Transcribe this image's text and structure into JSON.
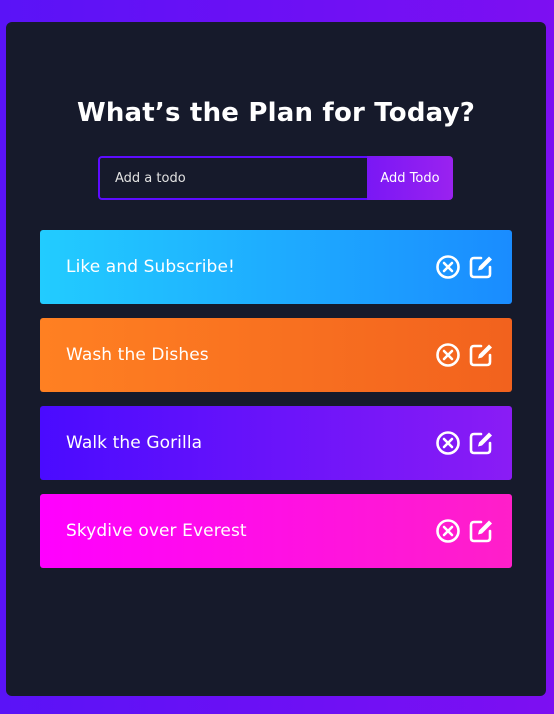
{
  "header": {
    "title": "What’s the Plan for Today?"
  },
  "form": {
    "placeholder": "Add a todo",
    "button_label": "Add Todo"
  },
  "todos": [
    {
      "text": "Like and Subscribe!",
      "gradient": [
        "#22ccff",
        "#1a8cff"
      ]
    },
    {
      "text": "Wash the Dishes",
      "gradient": [
        "#ff8022",
        "#f2621e"
      ]
    },
    {
      "text": "Walk the Gorilla",
      "gradient": [
        "#4a0bff",
        "#8a1cf5"
      ]
    },
    {
      "text": "Skydive over Everest",
      "gradient": [
        "#ff00ff",
        "#ff1fc9"
      ]
    }
  ],
  "icons": {
    "delete": "close-circle-icon",
    "edit": "edit-icon"
  },
  "colors": {
    "page_background": "#6a10f5",
    "app_background": "#161a2b",
    "input_border": "#5d0cff",
    "button_accent": "#8a1cf5",
    "text": "#ffffff"
  }
}
